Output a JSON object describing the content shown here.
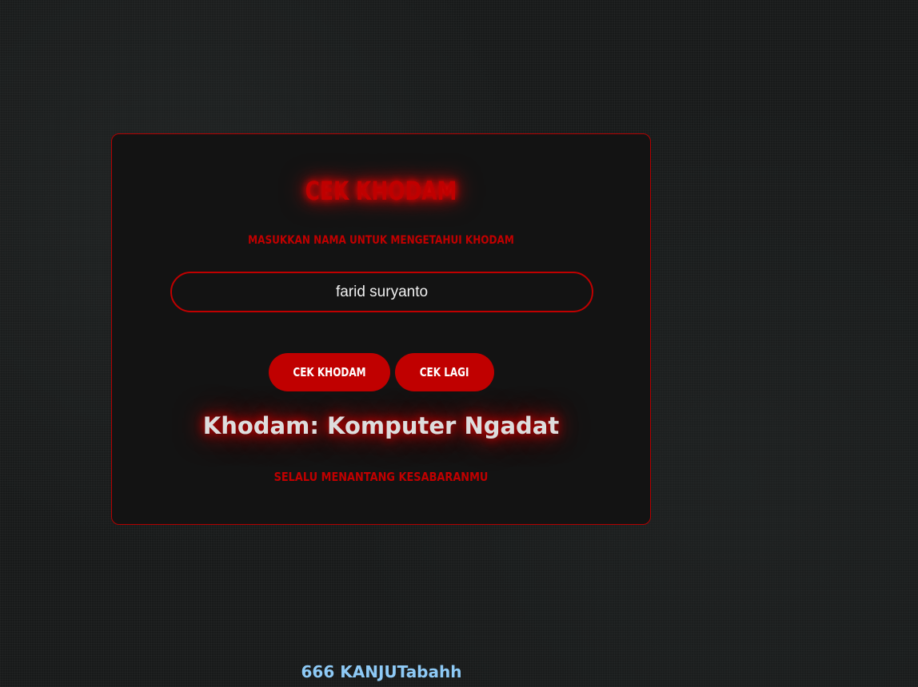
{
  "app": {
    "title": "CEK KHODAM",
    "subtitle": "MASUKKAN NAMA UNTUK MENGETAHUI KHODAM"
  },
  "form": {
    "name_value": "farid suryanto",
    "check_button_label": "CEK KHODAM",
    "retry_button_label": "CEK LAGI"
  },
  "result": {
    "text": "Khodam: Komputer Ngadat",
    "description": "SELALU MENANTANG KESABARANMU"
  },
  "footer": {
    "text": "666 KANJUTabahh"
  },
  "colors": {
    "accent": "#c00000",
    "card_background": "#131313",
    "page_background": "#181a1a",
    "footer_text": "#8ecaf6"
  }
}
